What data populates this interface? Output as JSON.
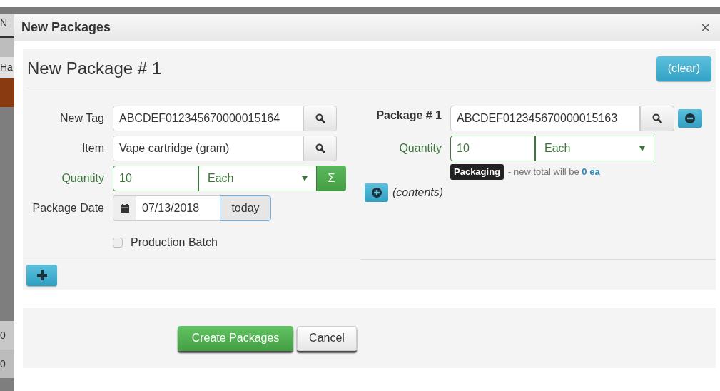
{
  "backdrop": {
    "fragments": [
      "N",
      "Ha",
      "0",
      "0"
    ]
  },
  "dialog": {
    "title": "New Packages",
    "close": "×"
  },
  "new_package": {
    "heading": "New Package # 1",
    "clear_button": "(clear)",
    "fields": [
      {
        "kind": "lookup",
        "label": "New Tag",
        "value": "ABCDEF012345670000015164"
      },
      {
        "kind": "lookup",
        "label": "Item",
        "value": "Vape cartridge (gram)"
      },
      {
        "kind": "quantity",
        "label": "Quantity",
        "value": "10",
        "unit": "Each",
        "sum_button": "Σ",
        "valid": true
      },
      {
        "kind": "date",
        "label": "Package Date",
        "value": "07/13/2018",
        "today_button": "today",
        "today_focused": true
      },
      {
        "kind": "checkbox",
        "label": "Production Batch",
        "checked": false
      }
    ]
  },
  "source_packages": [
    {
      "label": "Package # 1",
      "tag": "ABCDEF012345670000015163",
      "quantity_label": "Quantity",
      "quantity": "10",
      "unit": "Each",
      "valid": true,
      "badge": "Packaging",
      "note": "- new total will be",
      "total": "0 ea",
      "contents": "(contents)"
    }
  ],
  "footer_buttons": [
    {
      "kind": "primary",
      "label": "Create Packages"
    },
    {
      "kind": "default",
      "label": "Cancel"
    }
  ]
}
